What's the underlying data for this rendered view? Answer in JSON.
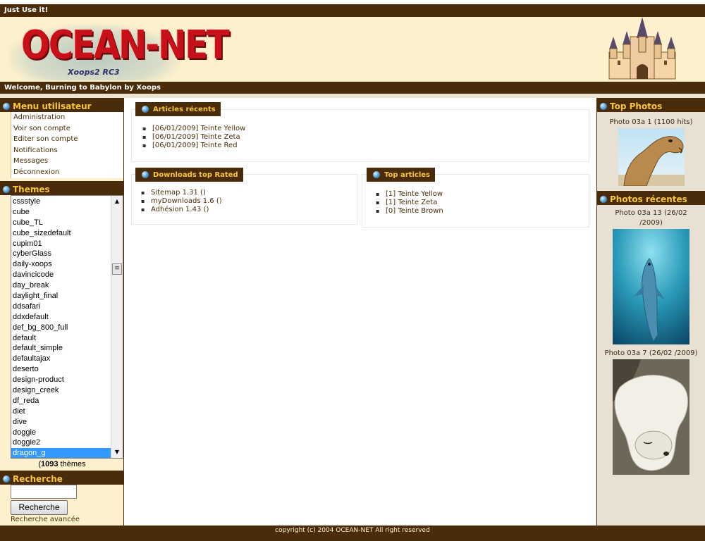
{
  "topbar": {
    "text": "Just Use it!"
  },
  "logo": {
    "text": "OCEAN-NET",
    "sub": "Xoops2 RC3",
    "accent": "#c8101a"
  },
  "welcome": {
    "text": "Welcome, Burning to Babylon by Xoops"
  },
  "colors": {
    "brand_brown": "#4a2c0b",
    "title_yellow": "#f6c637",
    "background_cream": "#fdf1cd",
    "selection": "#3399ff"
  },
  "user_menu": {
    "title": "Menu utilisateur",
    "items": [
      "Administration",
      "Voir son compte",
      "Editer son compte",
      "Notifications",
      "Messages",
      "Déconnexion"
    ]
  },
  "themes": {
    "title": "Themes",
    "items": [
      "cssstyle",
      "cube",
      "cube_TL",
      "cube_sizedefault",
      "cupim01",
      "cyberGlass",
      "daily-xoops",
      "davincicode",
      "day_break",
      "daylight_final",
      "ddsafari",
      "ddxdefault",
      "def_bg_800_full",
      "default",
      "default_simple",
      "defaultajax",
      "deserto",
      "design-product",
      "design_creek",
      "df_reda",
      "diet",
      "dive",
      "doggie",
      "doggie2",
      "dragon_g"
    ],
    "selected": "dragon_g",
    "count": "1093",
    "count_suffix": " thèmes",
    "count_open": "("
  },
  "search": {
    "title": "Recherche",
    "button": "Recherche",
    "advanced": "Recherche avancée"
  },
  "articles_recents": {
    "title": "Articles récents",
    "items": [
      "[06/01/2009] Teinte Yellow",
      "[06/01/2009] Teinte Zeta",
      "[06/01/2009] Teinte Red"
    ]
  },
  "downloads_top": {
    "title": "Downloads top Rated",
    "items": [
      "Sitemap 1.31 ()",
      "myDownloads 1.6 ()",
      "Adhésion 1.43 ()"
    ]
  },
  "top_articles": {
    "title": "Top articles",
    "items": [
      "[1] Teinte Yellow",
      "[1] Teinte Zeta",
      "[0] Teinte Brown"
    ]
  },
  "top_photos": {
    "title": "Top Photos",
    "items": [
      {
        "caption": "Photo 03a 1 (1100 hits)",
        "icon": "camel-photo"
      }
    ]
  },
  "recent_photos": {
    "title": "Photos récentes",
    "items": [
      {
        "caption": "Photo 03a 13 (26/02 /2009)",
        "icon": "dolphin-photo"
      },
      {
        "caption": "Photo 03a 7 (26/02 /2009)",
        "icon": "polar-bear-photo"
      }
    ]
  },
  "footer": {
    "text": "copyright (c) 2004 OCEAN-NET All right reserved"
  }
}
